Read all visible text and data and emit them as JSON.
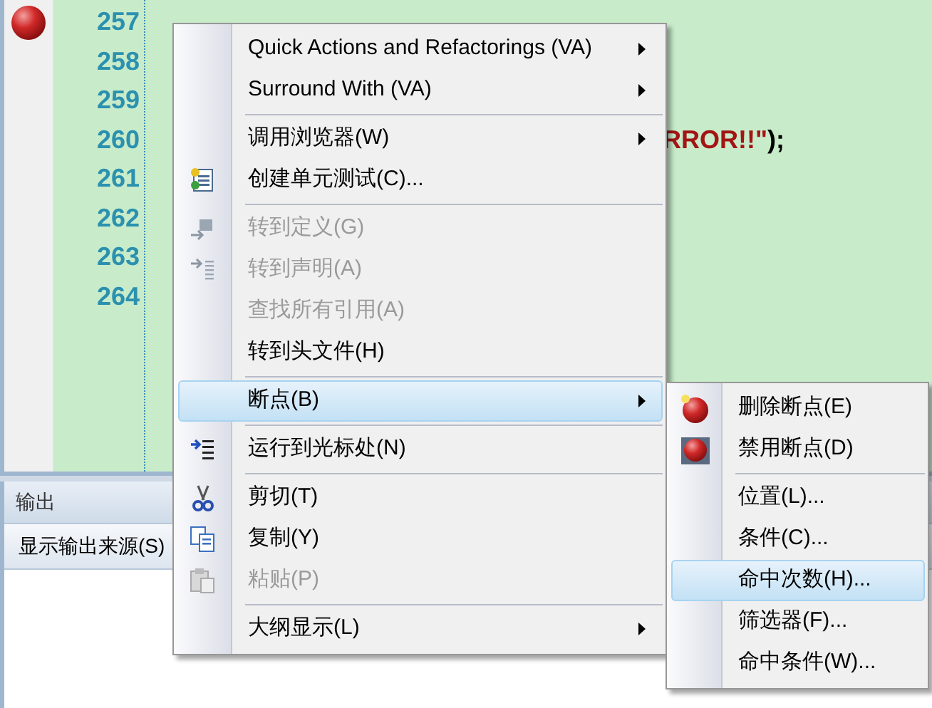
{
  "editor": {
    "lines": [
      {
        "number": "257",
        "breakpoint": true
      },
      {
        "number": "258",
        "breakpoint": false
      },
      {
        "number": "259",
        "breakpoint": false
      },
      {
        "number": "260",
        "breakpoint": false,
        "code": [
          {
            "kind": "string",
            "text": "RROR!!\""
          },
          {
            "kind": "plain",
            "text": ");"
          }
        ]
      },
      {
        "number": "261",
        "breakpoint": false
      },
      {
        "number": "262",
        "breakpoint": false
      },
      {
        "number": "263",
        "breakpoint": false
      },
      {
        "number": "264",
        "breakpoint": false
      }
    ]
  },
  "output_panel": {
    "title": "输出",
    "source_label": "显示输出来源(S)"
  },
  "context_menu": {
    "items": [
      {
        "kind": "command",
        "label": "Quick Actions and Refactorings (VA)",
        "submenu": true,
        "disabled": false,
        "selected": false
      },
      {
        "kind": "command",
        "label": "Surround With (VA)",
        "submenu": true,
        "disabled": false,
        "selected": false
      },
      {
        "kind": "separator"
      },
      {
        "kind": "command",
        "label": "调用浏览器(W)",
        "submenu": true,
        "disabled": false,
        "selected": false
      },
      {
        "kind": "command",
        "label": "创建单元测试(C)...",
        "submenu": false,
        "disabled": false,
        "selected": false
      },
      {
        "kind": "separator"
      },
      {
        "kind": "command",
        "label": "转到定义(G)",
        "submenu": false,
        "disabled": true,
        "selected": false
      },
      {
        "kind": "command",
        "label": "转到声明(A)",
        "submenu": false,
        "disabled": true,
        "selected": false
      },
      {
        "kind": "command",
        "label": "查找所有引用(A)",
        "submenu": false,
        "disabled": true,
        "selected": false
      },
      {
        "kind": "command",
        "label": "转到头文件(H)",
        "submenu": false,
        "disabled": false,
        "selected": false
      },
      {
        "kind": "separator"
      },
      {
        "kind": "command",
        "label": "断点(B)",
        "submenu": true,
        "disabled": false,
        "selected": true
      },
      {
        "kind": "separator"
      },
      {
        "kind": "command",
        "label": "运行到光标处(N)",
        "submenu": false,
        "disabled": false,
        "selected": false
      },
      {
        "kind": "separator"
      },
      {
        "kind": "command",
        "label": "剪切(T)",
        "submenu": false,
        "disabled": false,
        "selected": false
      },
      {
        "kind": "command",
        "label": "复制(Y)",
        "submenu": false,
        "disabled": false,
        "selected": false
      },
      {
        "kind": "command",
        "label": "粘贴(P)",
        "submenu": false,
        "disabled": true,
        "selected": false
      },
      {
        "kind": "separator"
      },
      {
        "kind": "command",
        "label": "大纲显示(L)",
        "submenu": true,
        "disabled": false,
        "selected": false
      }
    ]
  },
  "breakpoint_submenu": {
    "items": [
      {
        "kind": "command",
        "label": "删除断点(E)",
        "submenu": false,
        "disabled": false,
        "selected": false
      },
      {
        "kind": "command",
        "label": "禁用断点(D)",
        "submenu": false,
        "disabled": false,
        "selected": false
      },
      {
        "kind": "separator"
      },
      {
        "kind": "command",
        "label": "位置(L)...",
        "submenu": false,
        "disabled": false,
        "selected": false
      },
      {
        "kind": "command",
        "label": "条件(C)...",
        "submenu": false,
        "disabled": false,
        "selected": false
      },
      {
        "kind": "command",
        "label": "命中次数(H)...",
        "submenu": false,
        "disabled": false,
        "selected": true
      },
      {
        "kind": "command",
        "label": "筛选器(F)...",
        "submenu": false,
        "disabled": false,
        "selected": false
      },
      {
        "kind": "command",
        "label": "命中条件(W)...",
        "submenu": false,
        "disabled": false,
        "selected": false
      }
    ]
  }
}
